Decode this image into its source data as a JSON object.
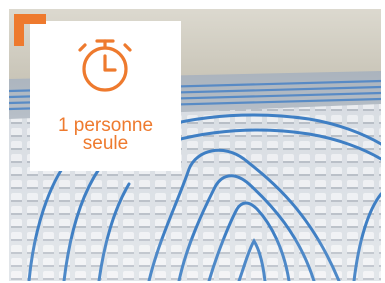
{
  "badge": {
    "line1": "1 personne",
    "line2": "seule",
    "icon": "stopwatch-icon",
    "accent_color": "#ee7a2e"
  },
  "photo": {
    "subject": "underfloor-heating-pipes"
  }
}
